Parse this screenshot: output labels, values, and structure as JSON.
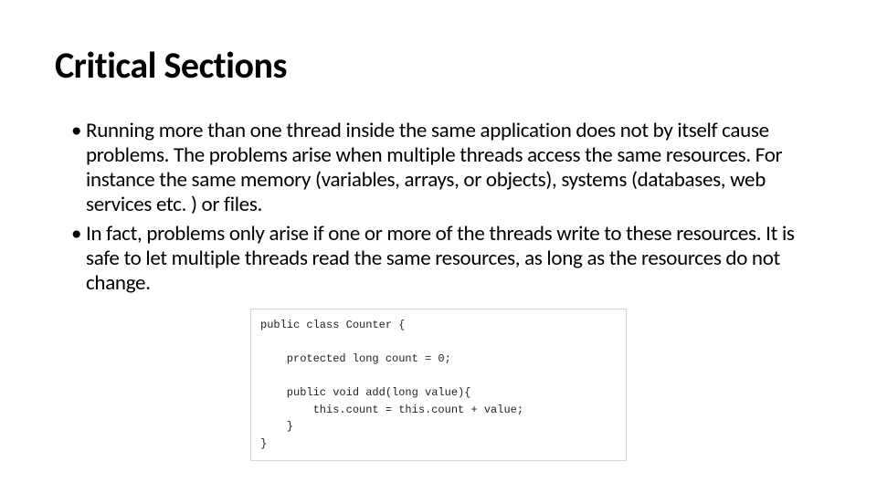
{
  "title": "Critical Sections",
  "bullets": [
    "Running more than one thread inside the same application does not by itself cause problems. The problems arise when multiple threads access the same resources. For instance the same memory (variables, arrays, or objects), systems (databases, web services etc. ) or files.",
    "In fact, problems only arise if one or more of the threads write to these resources. It is safe to let multiple threads read the same resources, as long as the resources do not change."
  ],
  "code": {
    "line1": "public class Counter {",
    "line2": "    protected long count = 0;",
    "line3": "    public void add(long value){",
    "line4": "        this.count = this.count + value;",
    "line5": "    }",
    "line6": "}"
  }
}
